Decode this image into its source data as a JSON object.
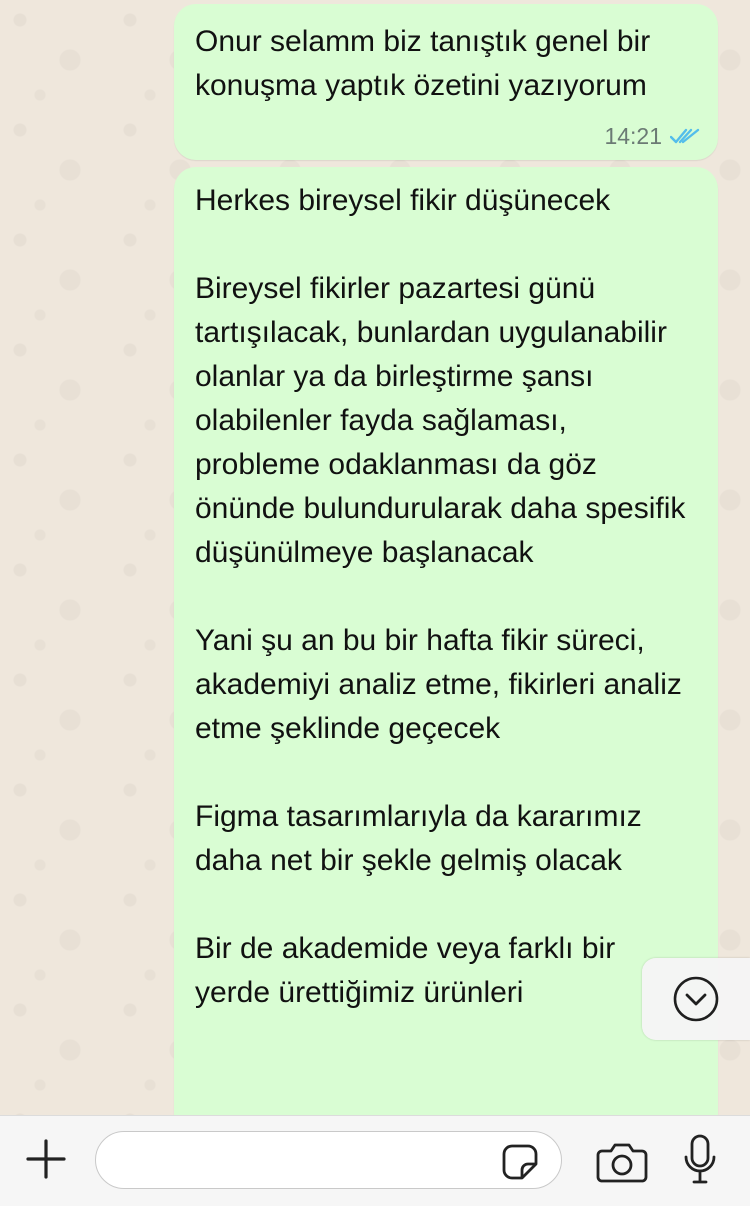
{
  "chat": {
    "messages": [
      {
        "text": "Onur selamm biz tanıştık genel bir konuşma yaptık özetini yazıyorum",
        "time": "14:21",
        "status": "read",
        "status_icon": "double-check-icon",
        "status_color": "#53bdeb"
      },
      {
        "text": "Herkes bireysel fikir düşünecek\n\nBireysel fikirler pazartesi günü tartışılacak, bunlardan uygulanabilir olanlar ya da birleştirme şansı olabilenler fayda sağlaması, probleme odaklanması da göz önünde bulundurularak daha spesifik düşünülmeye başlanacak\n\nYani şu an bu bir hafta fikir süreci, akademiyi analiz etme, fikirleri analiz etme şeklinde geçecek\n\nFigma tasarımlarıyla da kararımız daha net bir şekle gelmiş olacak\n\nBir de akademide veya farklı bir yerde ürettiğimiz ürünleri"
      }
    ],
    "bubble_color": "#d9fdd3",
    "scroll_down_icon": "chevron-down-icon"
  },
  "composer": {
    "input_value": "",
    "input_placeholder": "",
    "icons": [
      "plus-icon",
      "sticker-icon",
      "camera-icon",
      "microphone-icon"
    ]
  }
}
